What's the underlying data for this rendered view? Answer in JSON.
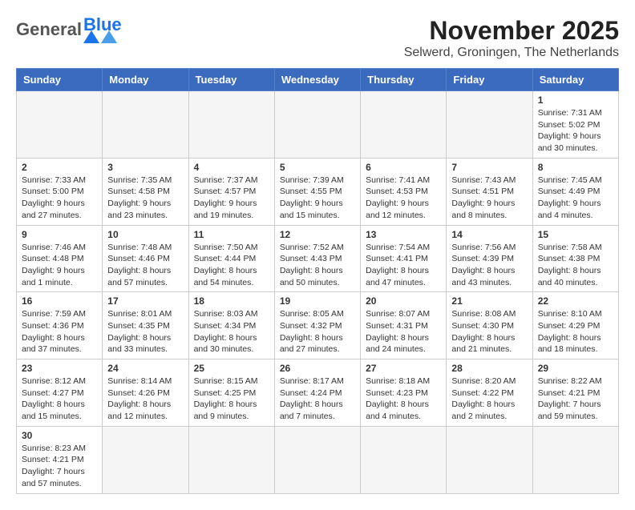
{
  "header": {
    "logo_text_general": "General",
    "logo_text_blue": "Blue",
    "month_title": "November 2025",
    "subtitle": "Selwerd, Groningen, The Netherlands"
  },
  "weekdays": [
    "Sunday",
    "Monday",
    "Tuesday",
    "Wednesday",
    "Thursday",
    "Friday",
    "Saturday"
  ],
  "days": [
    {
      "num": "",
      "info": ""
    },
    {
      "num": "",
      "info": ""
    },
    {
      "num": "",
      "info": ""
    },
    {
      "num": "",
      "info": ""
    },
    {
      "num": "",
      "info": ""
    },
    {
      "num": "",
      "info": ""
    },
    {
      "num": "1",
      "info": "Sunrise: 7:31 AM\nSunset: 5:02 PM\nDaylight: 9 hours and 30 minutes."
    },
    {
      "num": "2",
      "info": "Sunrise: 7:33 AM\nSunset: 5:00 PM\nDaylight: 9 hours and 27 minutes."
    },
    {
      "num": "3",
      "info": "Sunrise: 7:35 AM\nSunset: 4:58 PM\nDaylight: 9 hours and 23 minutes."
    },
    {
      "num": "4",
      "info": "Sunrise: 7:37 AM\nSunset: 4:57 PM\nDaylight: 9 hours and 19 minutes."
    },
    {
      "num": "5",
      "info": "Sunrise: 7:39 AM\nSunset: 4:55 PM\nDaylight: 9 hours and 15 minutes."
    },
    {
      "num": "6",
      "info": "Sunrise: 7:41 AM\nSunset: 4:53 PM\nDaylight: 9 hours and 12 minutes."
    },
    {
      "num": "7",
      "info": "Sunrise: 7:43 AM\nSunset: 4:51 PM\nDaylight: 9 hours and 8 minutes."
    },
    {
      "num": "8",
      "info": "Sunrise: 7:45 AM\nSunset: 4:49 PM\nDaylight: 9 hours and 4 minutes."
    },
    {
      "num": "9",
      "info": "Sunrise: 7:46 AM\nSunset: 4:48 PM\nDaylight: 9 hours and 1 minute."
    },
    {
      "num": "10",
      "info": "Sunrise: 7:48 AM\nSunset: 4:46 PM\nDaylight: 8 hours and 57 minutes."
    },
    {
      "num": "11",
      "info": "Sunrise: 7:50 AM\nSunset: 4:44 PM\nDaylight: 8 hours and 54 minutes."
    },
    {
      "num": "12",
      "info": "Sunrise: 7:52 AM\nSunset: 4:43 PM\nDaylight: 8 hours and 50 minutes."
    },
    {
      "num": "13",
      "info": "Sunrise: 7:54 AM\nSunset: 4:41 PM\nDaylight: 8 hours and 47 minutes."
    },
    {
      "num": "14",
      "info": "Sunrise: 7:56 AM\nSunset: 4:39 PM\nDaylight: 8 hours and 43 minutes."
    },
    {
      "num": "15",
      "info": "Sunrise: 7:58 AM\nSunset: 4:38 PM\nDaylight: 8 hours and 40 minutes."
    },
    {
      "num": "16",
      "info": "Sunrise: 7:59 AM\nSunset: 4:36 PM\nDaylight: 8 hours and 37 minutes."
    },
    {
      "num": "17",
      "info": "Sunrise: 8:01 AM\nSunset: 4:35 PM\nDaylight: 8 hours and 33 minutes."
    },
    {
      "num": "18",
      "info": "Sunrise: 8:03 AM\nSunset: 4:34 PM\nDaylight: 8 hours and 30 minutes."
    },
    {
      "num": "19",
      "info": "Sunrise: 8:05 AM\nSunset: 4:32 PM\nDaylight: 8 hours and 27 minutes."
    },
    {
      "num": "20",
      "info": "Sunrise: 8:07 AM\nSunset: 4:31 PM\nDaylight: 8 hours and 24 minutes."
    },
    {
      "num": "21",
      "info": "Sunrise: 8:08 AM\nSunset: 4:30 PM\nDaylight: 8 hours and 21 minutes."
    },
    {
      "num": "22",
      "info": "Sunrise: 8:10 AM\nSunset: 4:29 PM\nDaylight: 8 hours and 18 minutes."
    },
    {
      "num": "23",
      "info": "Sunrise: 8:12 AM\nSunset: 4:27 PM\nDaylight: 8 hours and 15 minutes."
    },
    {
      "num": "24",
      "info": "Sunrise: 8:14 AM\nSunset: 4:26 PM\nDaylight: 8 hours and 12 minutes."
    },
    {
      "num": "25",
      "info": "Sunrise: 8:15 AM\nSunset: 4:25 PM\nDaylight: 8 hours and 9 minutes."
    },
    {
      "num": "26",
      "info": "Sunrise: 8:17 AM\nSunset: 4:24 PM\nDaylight: 8 hours and 7 minutes."
    },
    {
      "num": "27",
      "info": "Sunrise: 8:18 AM\nSunset: 4:23 PM\nDaylight: 8 hours and 4 minutes."
    },
    {
      "num": "28",
      "info": "Sunrise: 8:20 AM\nSunset: 4:22 PM\nDaylight: 8 hours and 2 minutes."
    },
    {
      "num": "29",
      "info": "Sunrise: 8:22 AM\nSunset: 4:21 PM\nDaylight: 7 hours and 59 minutes."
    },
    {
      "num": "30",
      "info": "Sunrise: 8:23 AM\nSunset: 4:21 PM\nDaylight: 7 hours and 57 minutes."
    }
  ]
}
